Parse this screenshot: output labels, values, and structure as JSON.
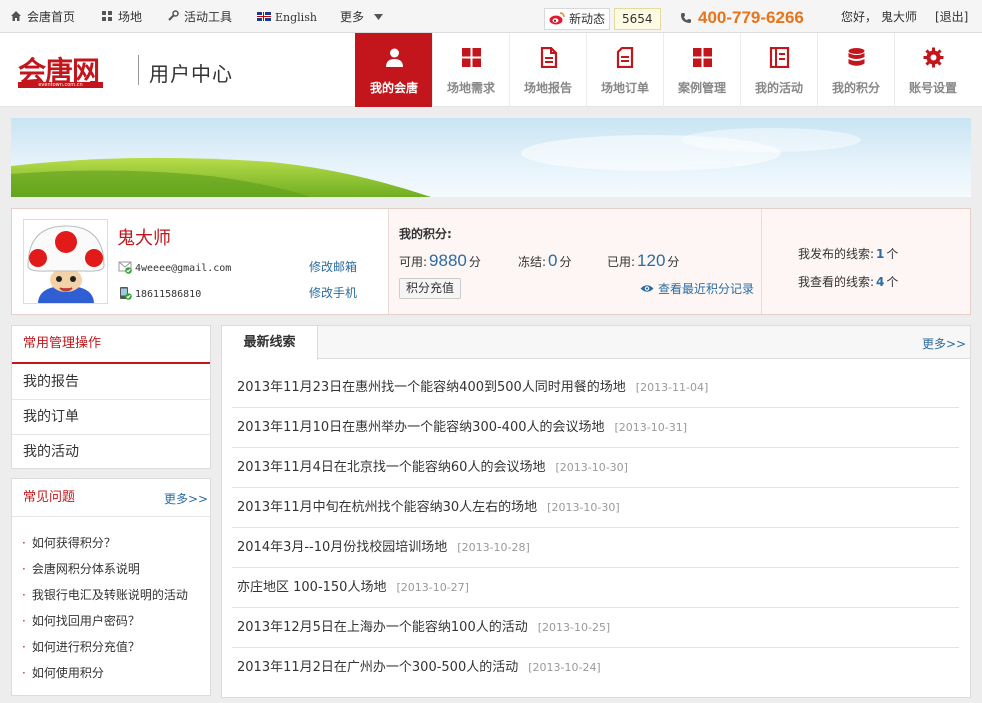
{
  "topbar": {
    "home": "会唐首页",
    "venues": "场地",
    "tools": "活动工具",
    "english": "English",
    "more": "更多",
    "news_label": "新动态",
    "news_count": "5654",
    "phone": "400-779-6266",
    "greeting": "您好，",
    "username": "鬼大师",
    "logout": "[退出]"
  },
  "header": {
    "logo_text": "会唐网",
    "logo_sub": "eventown.com.cn",
    "title": "用户中心",
    "nav": [
      {
        "label": "我的会唐",
        "icon": "user-icon",
        "active": true
      },
      {
        "label": "场地需求",
        "icon": "grid-icon",
        "active": false
      },
      {
        "label": "场地报告",
        "icon": "report-icon",
        "active": false
      },
      {
        "label": "场地订单",
        "icon": "order-icon",
        "active": false
      },
      {
        "label": "案例管理",
        "icon": "grid-icon",
        "active": false
      },
      {
        "label": "我的活动",
        "icon": "activity-icon",
        "active": false
      },
      {
        "label": "我的积分",
        "icon": "database-icon",
        "active": false
      },
      {
        "label": "账号设置",
        "icon": "gear-icon",
        "active": false
      }
    ]
  },
  "profile": {
    "name": "鬼大师",
    "email": "4weeee@gmail.com",
    "phone": "18611586810",
    "edit_email": "修改邮箱",
    "edit_phone": "修改手机",
    "points_title": "我的积分:",
    "available_label": "可用:",
    "available": "9880",
    "frozen_label": "冻结:",
    "frozen": "0",
    "used_label": "已用:",
    "used": "120",
    "unit": "分",
    "recharge": "积分充值",
    "view_records": "查看最近积分记录",
    "posted_label": "我发布的线索:",
    "posted_count": "1",
    "viewed_label": "我查看的线索:",
    "viewed_count": "4",
    "count_unit": "个"
  },
  "common_ops": {
    "title": "常用管理操作",
    "items": [
      "我的报告",
      "我的订单",
      "我的活动"
    ]
  },
  "faq": {
    "title": "常见问题",
    "more": "更多>>",
    "items": [
      "如何获得积分？",
      "会唐网积分体系说明",
      "我银行电汇及转账说明的活动",
      "如何找回用户密码？",
      "如何进行积分充值？",
      "如何使用积分"
    ]
  },
  "leads": {
    "tab": "最新线索",
    "more": "更多>>",
    "items": [
      {
        "title": "2013年11月23日在惠州找一个能容纳400到500人同时用餐的场地",
        "date": "[2013-11-04]"
      },
      {
        "title": "2013年11月10日在惠州举办一个能容纳300-400人的会议场地",
        "date": "[2013-10-31]"
      },
      {
        "title": "2013年11月4日在北京找一个能容纳60人的会议场地",
        "date": "[2013-10-30]"
      },
      {
        "title": "2013年11月中旬在杭州找个能容纳30人左右的场地",
        "date": "[2013-10-30]"
      },
      {
        "title": "2014年3月--10月份找校园培训场地",
        "date": "[2013-10-28]"
      },
      {
        "title": "亦庄地区 100-150人场地",
        "date": "[2013-10-27]"
      },
      {
        "title": "2013年12月5日在上海办一个能容纳100人的活动",
        "date": "[2013-10-25]"
      },
      {
        "title": "2013年11月2日在广州办一个300-500人的活动",
        "date": "[2013-10-24]"
      }
    ]
  },
  "colors": {
    "brand_red": "#c3161c",
    "link_blue": "#2b6ca3",
    "phone_orange": "#e8741a"
  }
}
